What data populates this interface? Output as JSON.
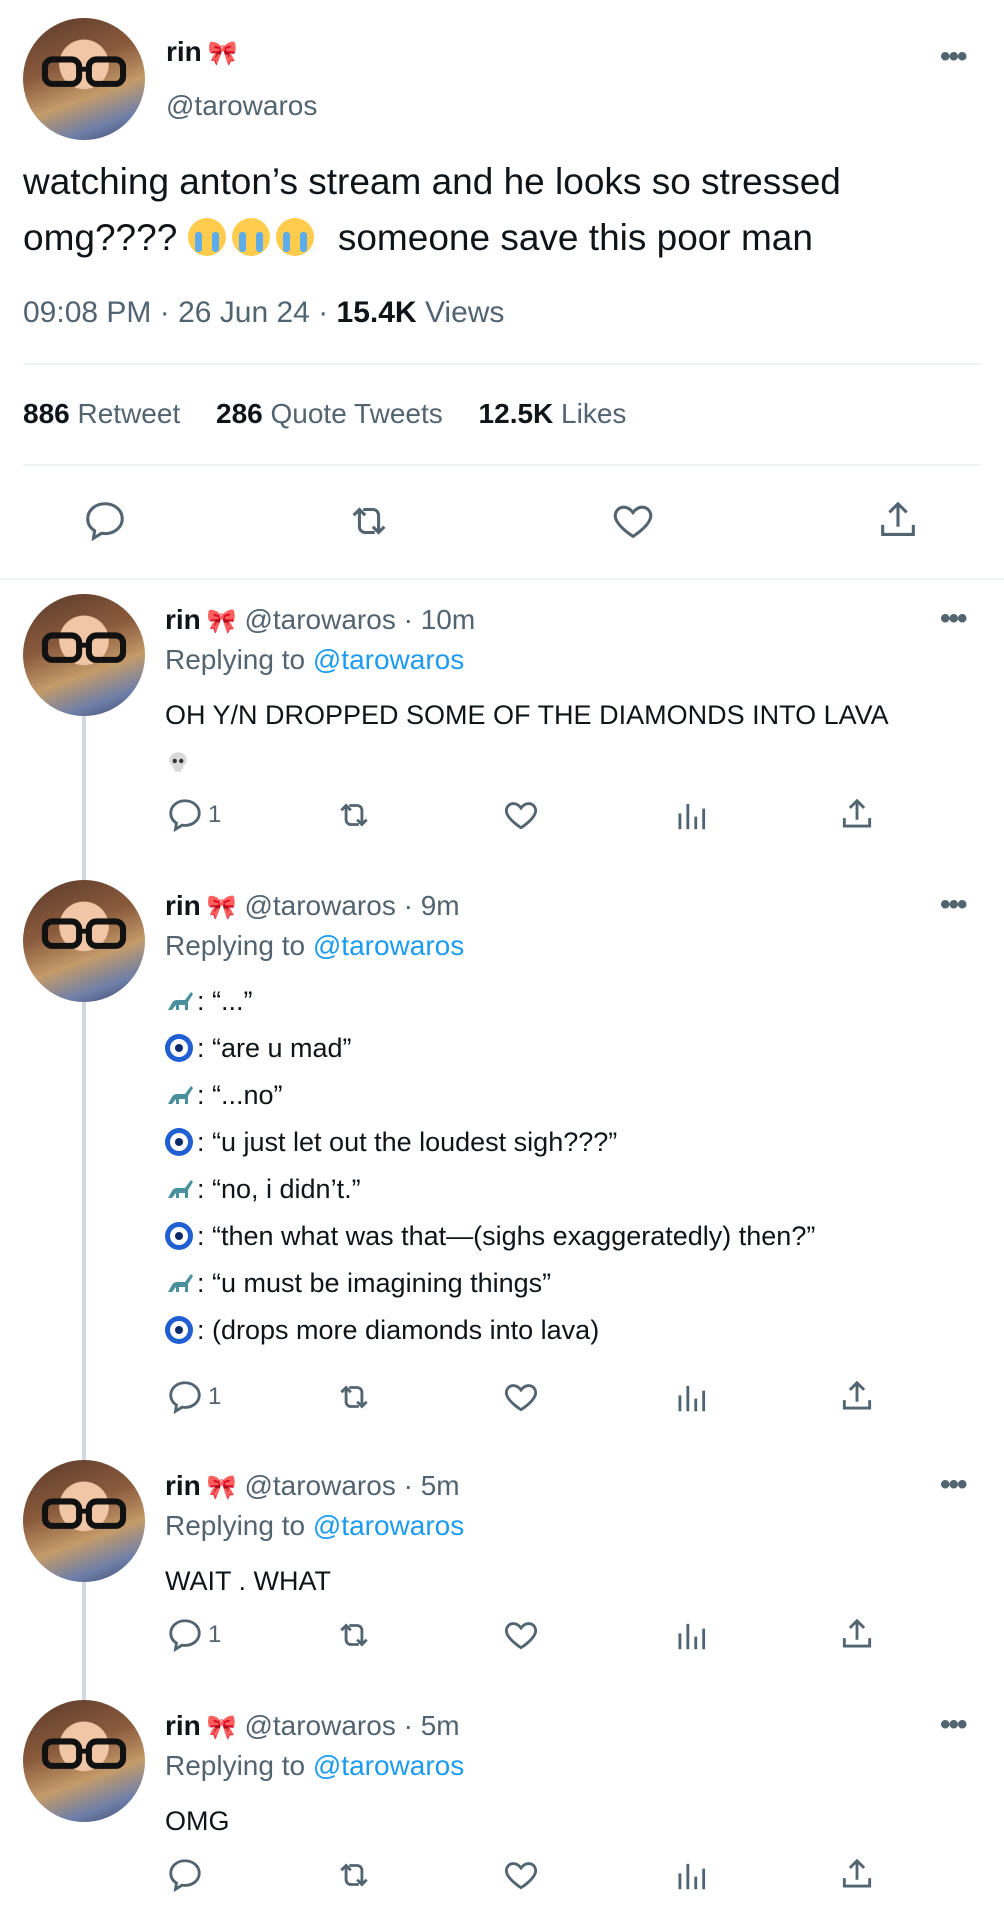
{
  "main": {
    "display_name": "rin",
    "handle": "@tarowaros",
    "text_line1": "watching anton’s stream and he looks so stressed",
    "text_line2_start": "omg????",
    "text_line2_end": "someone save this poor man",
    "time": "09:08 PM",
    "date": "26 Jun 24",
    "views_count": "15.4K",
    "views_label": "Views",
    "retweets_count": "886",
    "retweets_label": "Retweet",
    "quotes_count": "286",
    "quotes_label": "Quote Tweets",
    "likes_count": "12.5K",
    "likes_label": "Likes"
  },
  "replies": [
    {
      "display_name": "rin",
      "handle": "@tarowaros",
      "time": "· 10m",
      "replying_prefix": "Replying to",
      "replying_to": "@tarowaros",
      "text": "OH Y/N DROPPED SOME OF THE DIAMONDS INTO LAVA",
      "reply_count": "1"
    },
    {
      "display_name": "rin",
      "handle": "@tarowaros",
      "time": "· 9m",
      "replying_prefix": "Replying to",
      "replying_to": "@tarowaros",
      "lines": [
        ": “...”",
        ": “are u mad”",
        ": “...no”",
        ": “u just let out the loudest sigh???”",
        ": “no, i didn’t.”",
        ": “then what was that—(sighs exaggeratedly) then?”",
        ": “u must be imagining things”",
        ": (drops more diamonds into lava)"
      ],
      "reply_count": "1"
    },
    {
      "display_name": "rin",
      "handle": "@tarowaros",
      "time": "· 5m",
      "replying_prefix": "Replying to",
      "replying_to": "@tarowaros",
      "text": "WAIT . WHAT",
      "reply_count": "1"
    },
    {
      "display_name": "rin",
      "handle": "@tarowaros",
      "time": "· 5m",
      "replying_prefix": "Replying to",
      "replying_to": "@tarowaros",
      "text": "OMG",
      "reply_count": ""
    }
  ],
  "icons": {
    "bow": "🎀",
    "more": "•••",
    "colors": {
      "link": "#1d9bf0",
      "muted": "#536471",
      "text": "#0f1419"
    }
  }
}
